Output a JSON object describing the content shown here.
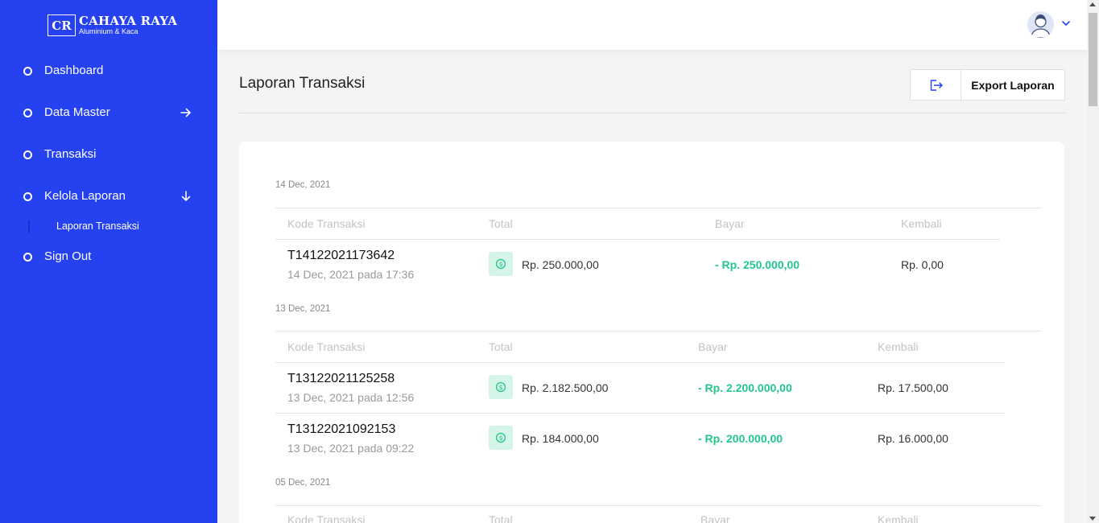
{
  "brand": {
    "logo_initials": "CR",
    "name": "CAHAYA RAYA",
    "subtitle": "Aluminium & Kaca"
  },
  "sidebar": {
    "items": [
      {
        "label": "Dashboard"
      },
      {
        "label": "Data Master",
        "icon": "arrow-right-icon"
      },
      {
        "label": "Transaksi"
      },
      {
        "label": "Kelola Laporan",
        "icon": "arrow-down-icon"
      },
      {
        "label": "Sign Out"
      }
    ],
    "subitems": [
      {
        "label": "Laporan Transaksi"
      }
    ]
  },
  "header": {
    "title": "Laporan Transaksi",
    "export_label": "Export Laporan"
  },
  "table_headers": {
    "code": "Kode Transaksi",
    "total": "Total",
    "paid": "Bayar",
    "change": "Kembali"
  },
  "groups": [
    {
      "date": "14 Dec, 2021",
      "rows": [
        {
          "code": "T14122021173642",
          "datetime": "14 Dec, 2021 pada 17:36",
          "total": "Rp. 250.000,00",
          "paid": "- Rp. 250.000,00",
          "change": "Rp. 0,00"
        }
      ]
    },
    {
      "date": "13 Dec, 2021",
      "rows": [
        {
          "code": "T13122021125258",
          "datetime": "13 Dec, 2021 pada 12:56",
          "total": "Rp. 2.182.500,00",
          "paid": "- Rp. 2.200.000,00",
          "change": "Rp. 17.500,00"
        },
        {
          "code": "T13122021092153",
          "datetime": "13 Dec, 2021 pada 09:22",
          "total": "Rp. 184.000,00",
          "paid": "- Rp. 200.000,00",
          "change": "Rp. 16.000,00"
        }
      ]
    },
    {
      "date": "05 Dec, 2021",
      "rows": []
    }
  ],
  "colors": {
    "sidebar": "#2541f0",
    "accent_green": "#22c78a",
    "icon_bg": "#d4f5e8"
  }
}
